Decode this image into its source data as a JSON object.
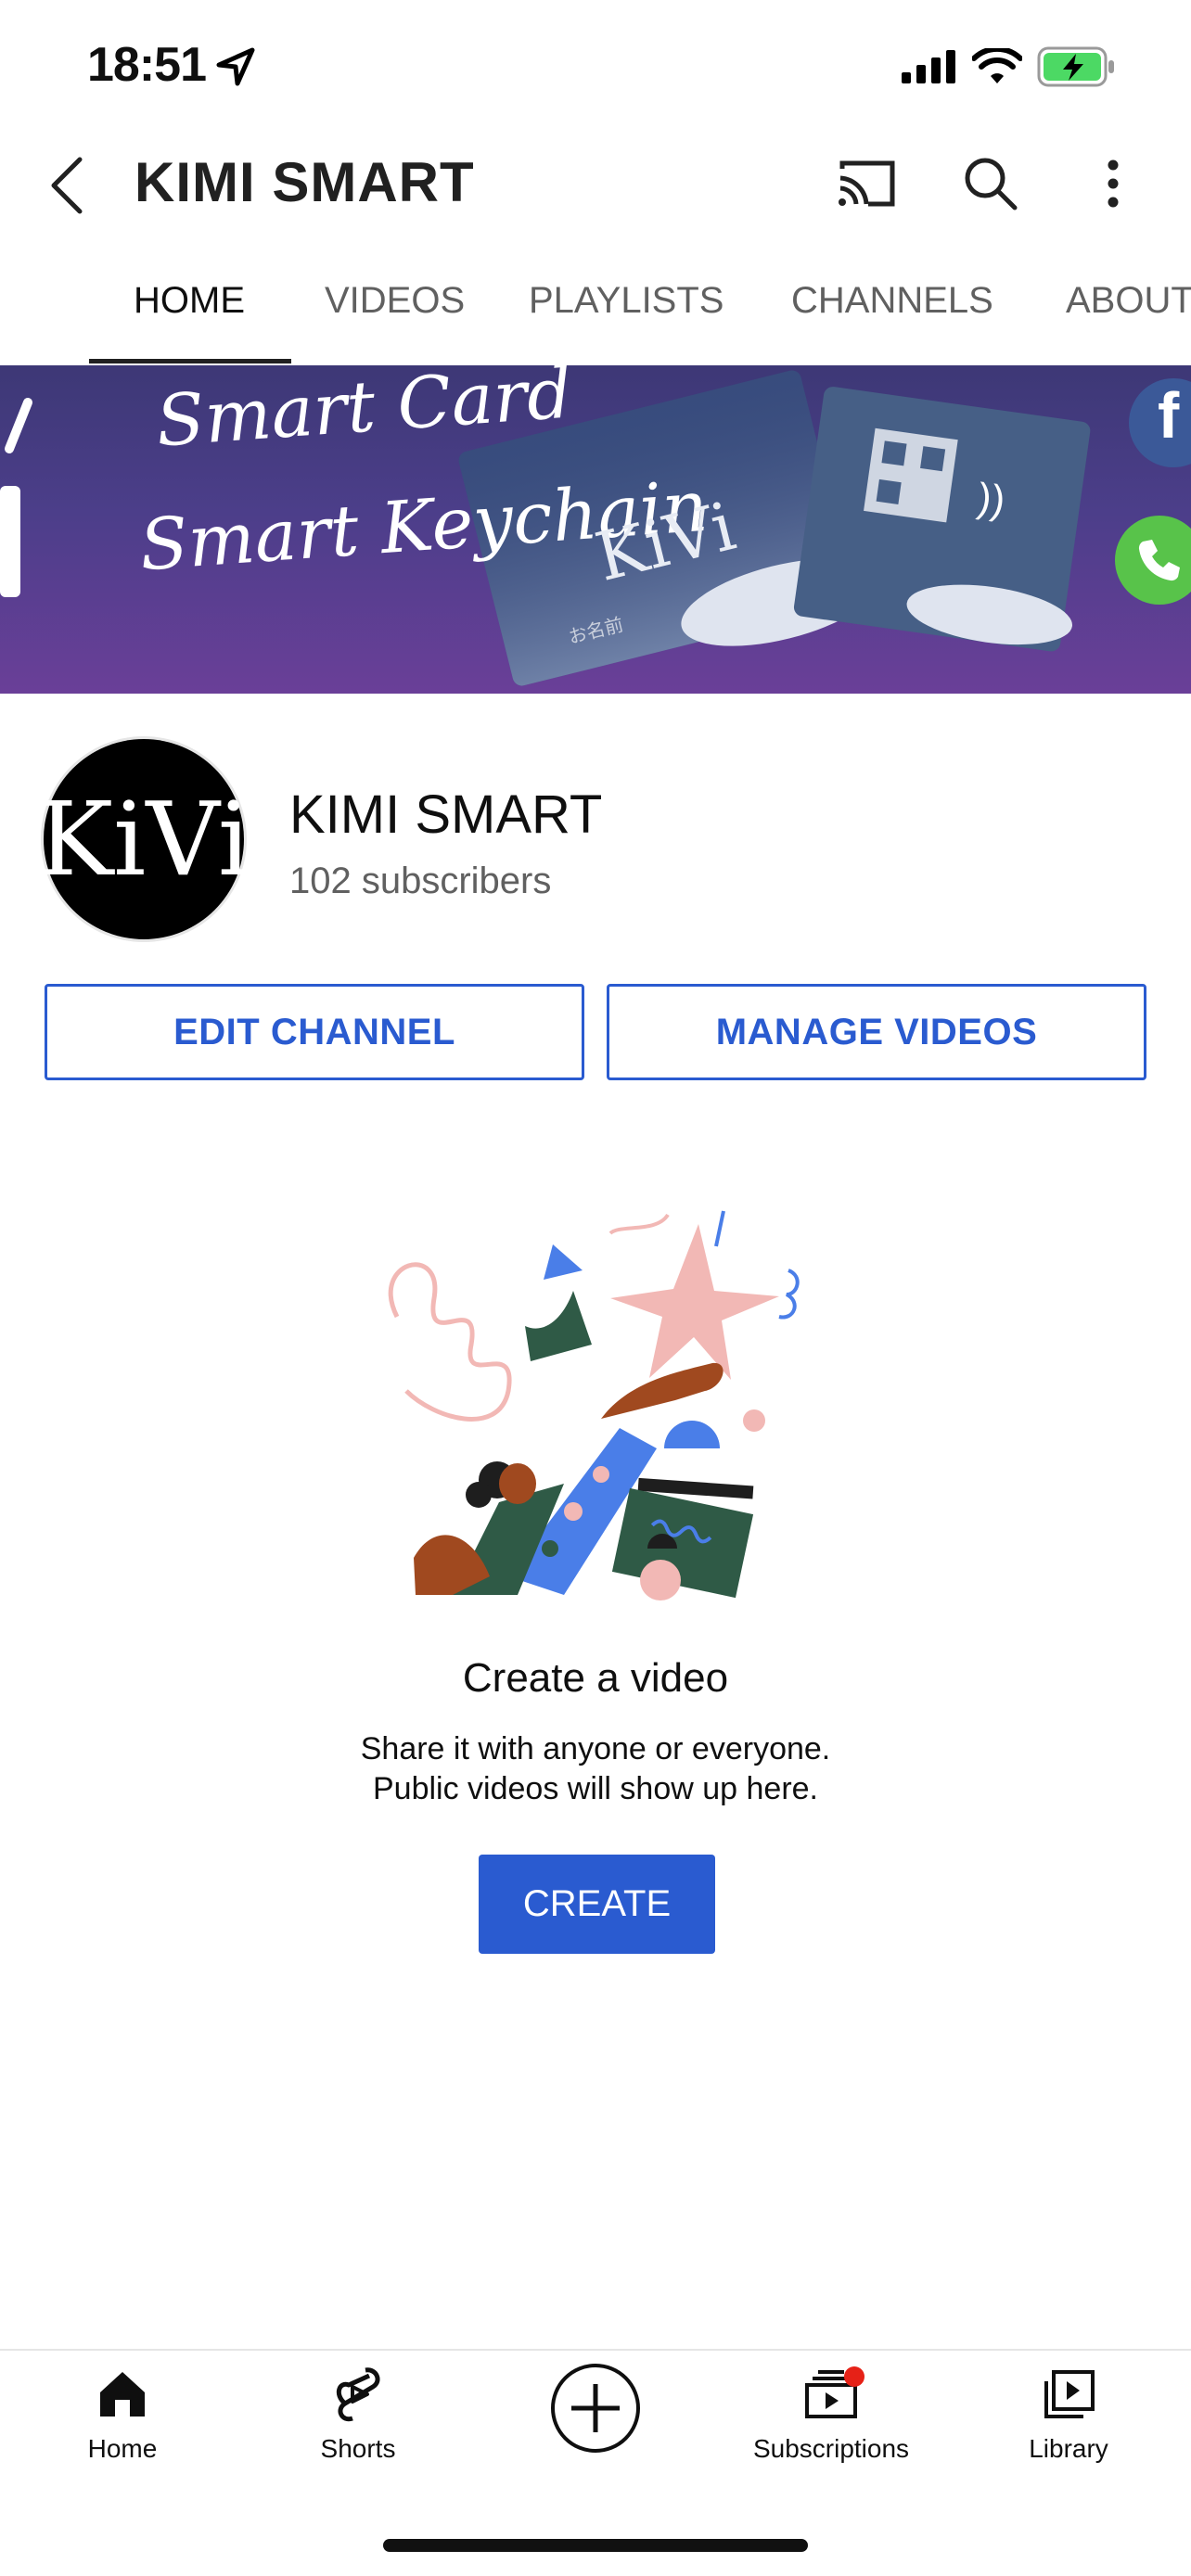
{
  "status_bar": {
    "time": "18:51"
  },
  "header": {
    "title": "KIMI SMART"
  },
  "tabs": [
    {
      "label": "HOME",
      "active": true
    },
    {
      "label": "VIDEOS",
      "active": false
    },
    {
      "label": "PLAYLISTS",
      "active": false
    },
    {
      "label": "CHANNELS",
      "active": false
    },
    {
      "label": "ABOUT",
      "active": false
    }
  ],
  "banner": {
    "line1": "Smart Card",
    "line2": "Smart Keychain",
    "card_logo": "KiVi",
    "card_small_text": "お名前"
  },
  "channel": {
    "avatar_text": "KiVi",
    "name": "KIMI SMART",
    "subscribers": "102 subscribers",
    "edit_label": "EDIT CHANNEL",
    "manage_label": "MANAGE VIDEOS"
  },
  "empty_state": {
    "title": "Create a video",
    "description_line1": "Share it with anyone or everyone.",
    "description_line2": "Public videos will show up here.",
    "create_label": "CREATE"
  },
  "bottom_nav": [
    {
      "label": "Home",
      "icon": "home-icon",
      "active": true
    },
    {
      "label": "Shorts",
      "icon": "shorts-icon"
    },
    {
      "label": "",
      "icon": "create-plus-icon"
    },
    {
      "label": "Subscriptions",
      "icon": "subscriptions-icon",
      "badge": true
    },
    {
      "label": "Library",
      "icon": "library-icon"
    }
  ],
  "colors": {
    "accent": "#2a5bd0",
    "notification": "#e62117",
    "battery": "#4cd964"
  }
}
